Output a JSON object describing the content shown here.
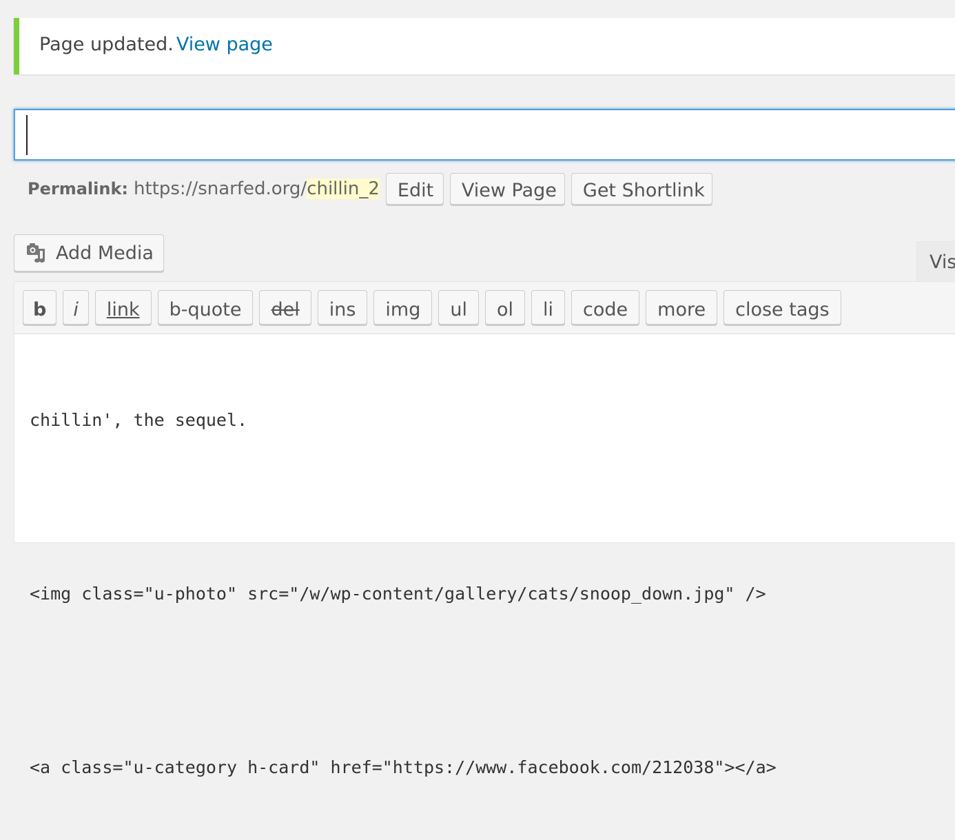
{
  "notice": {
    "message": "Page updated.",
    "link_label": "View page"
  },
  "title": {
    "value": "",
    "placeholder": ""
  },
  "permalink": {
    "label": "Permalink:",
    "base_url": "https://snarfed.org/",
    "slug": "chillin_2",
    "buttons": {
      "edit": "Edit",
      "view_page": "View Page",
      "get_shortlink": "Get Shortlink"
    }
  },
  "media": {
    "add_media_label": "Add Media",
    "icon": "media-camera-music-icon"
  },
  "editor_tabs": {
    "visual": "Vis"
  },
  "quicktags": {
    "b": "b",
    "i": "i",
    "link": "link",
    "bquote": "b-quote",
    "del": "del",
    "ins": "ins",
    "img": "img",
    "ul": "ul",
    "ol": "ol",
    "li": "li",
    "code": "code",
    "more": "more",
    "close_tags": "close tags"
  },
  "content": {
    "lines": [
      "chillin', the sequel.",
      "",
      "<img class=\"u-photo\" src=\"/w/wp-content/gallery/cats/snoop_down.jpg\" />",
      "",
      "<a class=\"u-category h-card\" href=\"https://www.facebook.com/212038\"></a>"
    ]
  },
  "colors": {
    "notice_border": "#7ad03a",
    "link": "#0073aa",
    "focus_border": "#5b9dd9",
    "slug_highlight": "#fffbcc"
  }
}
